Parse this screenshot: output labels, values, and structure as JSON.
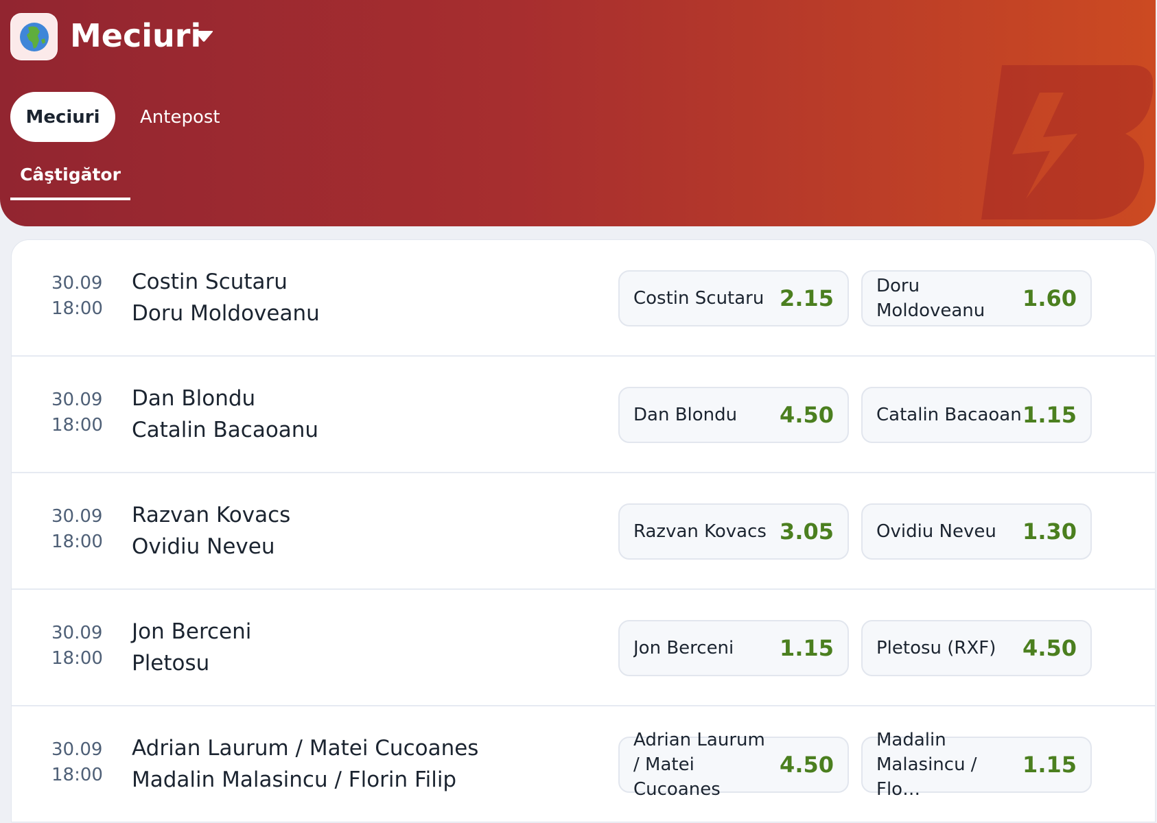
{
  "header": {
    "title": "Meciuri",
    "tabs": [
      {
        "label": "Meciuri",
        "active": true
      },
      {
        "label": "Antepost",
        "active": false
      }
    ],
    "subtab": "Câştigător"
  },
  "colors": {
    "header_start": "#922530",
    "header_end": "#cc4a22",
    "odds_value": "#4b7f1f",
    "text_dark": "#1b2430",
    "time_text": "#4f6077"
  },
  "matches": [
    {
      "date": "30.09",
      "time": "18:00",
      "player1": "Costin Scutaru",
      "player2": "Doru Moldoveanu",
      "odd1_label": "Costin Scutaru",
      "odd1_value": "2.15",
      "odd2_label": "Doru Moldoveanu",
      "odd2_value": "1.60"
    },
    {
      "date": "30.09",
      "time": "18:00",
      "player1": "Dan Blondu",
      "player2": "Catalin Bacaoanu",
      "odd1_label": "Dan Blondu",
      "odd1_value": "4.50",
      "odd2_label": "Catalin Bacaoanu",
      "odd2_value": "1.15"
    },
    {
      "date": "30.09",
      "time": "18:00",
      "player1": "Razvan Kovacs",
      "player2": "Ovidiu Neveu",
      "odd1_label": "Razvan Kovacs",
      "odd1_value": "3.05",
      "odd2_label": "Ovidiu Neveu",
      "odd2_value": "1.30"
    },
    {
      "date": "30.09",
      "time": "18:00",
      "player1": "Jon Berceni",
      "player2": "Pletosu",
      "odd1_label": "Jon Berceni",
      "odd1_value": "1.15",
      "odd2_label": "Pletosu (RXF)",
      "odd2_value": "4.50"
    },
    {
      "date": "30.09",
      "time": "18:00",
      "player1": "Adrian Laurum / Matei Cucoanes",
      "player2": "Madalin Malasincu / Florin Filip",
      "odd1_label": "Adrian Laurum / Matei Cucoanes",
      "odd1_value": "4.50",
      "odd2_label": "Madalin Malasincu / Flo…",
      "odd2_value": "1.15"
    }
  ]
}
